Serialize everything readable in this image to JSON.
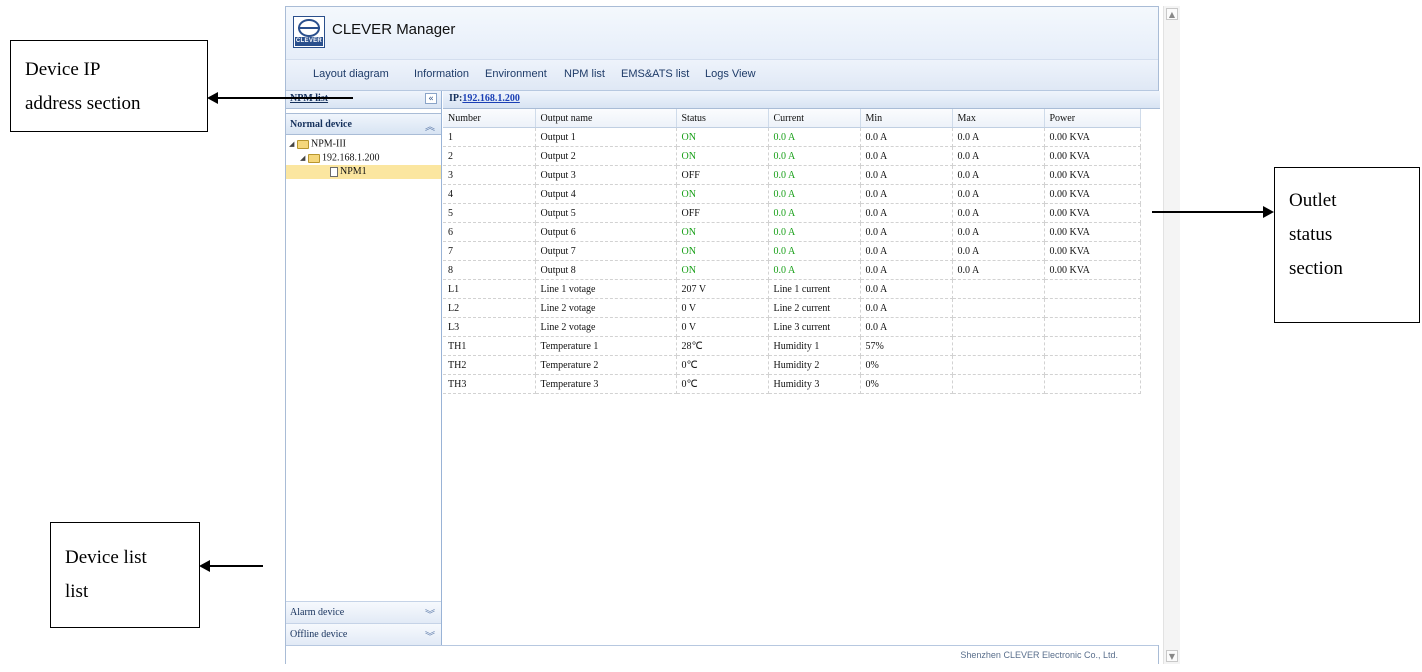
{
  "app": {
    "title": "CLEVER Manager",
    "logo_text": "CLEVER"
  },
  "menu": {
    "items": [
      "Layout diagram",
      "Information",
      "Environment",
      "NPM list",
      "EMS&ATS list",
      "Logs View"
    ]
  },
  "left_panel": {
    "header": "NPM list",
    "collapse_glyph": "«",
    "sections": {
      "normal": "Normal device",
      "alarm": "Alarm device",
      "offline": "Offline device"
    },
    "tree": {
      "root": "NPM-III",
      "ip_node": "192.168.1.200",
      "device": "NPM1"
    }
  },
  "main": {
    "ip_prefix": "IP:",
    "ip_value": "192.168.1.200",
    "columns": [
      "Number",
      "Output name",
      "Status",
      "Current",
      "Min",
      "Max",
      "Power"
    ],
    "rows": [
      [
        "1",
        "Output 1",
        "ON",
        "0.0 A",
        "0.0 A",
        "0.0 A",
        "0.00 KVA"
      ],
      [
        "2",
        "Output 2",
        "ON",
        "0.0 A",
        "0.0 A",
        "0.0 A",
        "0.00 KVA"
      ],
      [
        "3",
        "Output 3",
        "OFF",
        "0.0 A",
        "0.0 A",
        "0.0 A",
        "0.00 KVA"
      ],
      [
        "4",
        "Output 4",
        "ON",
        "0.0 A",
        "0.0 A",
        "0.0 A",
        "0.00 KVA"
      ],
      [
        "5",
        "Output 5",
        "OFF",
        "0.0 A",
        "0.0 A",
        "0.0 A",
        "0.00 KVA"
      ],
      [
        "6",
        "Output 6",
        "ON",
        "0.0 A",
        "0.0 A",
        "0.0 A",
        "0.00 KVA"
      ],
      [
        "7",
        "Output 7",
        "ON",
        "0.0 A",
        "0.0 A",
        "0.0 A",
        "0.00 KVA"
      ],
      [
        "8",
        "Output 8",
        "ON",
        "0.0 A",
        "0.0 A",
        "0.0 A",
        "0.00 KVA"
      ],
      [
        "L1",
        "Line 1 votage",
        "207 V",
        "Line 1 current",
        "0.0 A",
        "",
        ""
      ],
      [
        "L2",
        "Line 2 votage",
        "0 V",
        "Line 2 current",
        "0.0 A",
        "",
        ""
      ],
      [
        "L3",
        "Line 2 votage",
        "0 V",
        "Line 3 current",
        "0.0 A",
        "",
        ""
      ],
      [
        "TH1",
        "Temperature 1",
        "28℃",
        "Humidity 1",
        "57%",
        "",
        ""
      ],
      [
        "TH2",
        "Temperature 2",
        "0℃",
        "Humidity 2",
        "0%",
        "",
        ""
      ],
      [
        "TH3",
        "Temperature 3",
        "0℃",
        "Humidity 3",
        "0%",
        "",
        ""
      ]
    ],
    "on_color": "#19a019"
  },
  "footer": {
    "company": "Shenzhen CLEVER Electronic Co., Ltd."
  },
  "annotations": {
    "ip_section": [
      "Device IP",
      "address section"
    ],
    "outlet_section": [
      "Outlet",
      "status",
      "section"
    ],
    "device_list_section": [
      "Device list",
      "list"
    ]
  }
}
